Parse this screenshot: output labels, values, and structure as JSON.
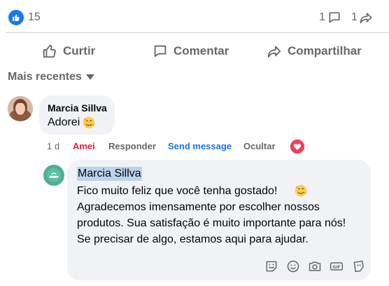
{
  "stats": {
    "reactions_count": "15",
    "comments_count": "1",
    "shares_count": "1"
  },
  "actions": {
    "like": "Curtir",
    "comment": "Comentar",
    "share": "Compartilhar"
  },
  "sort": {
    "label": "Mais recentes"
  },
  "comment": {
    "author": "Marcia Sillva",
    "text": "Adorei",
    "time": "1 d",
    "reaction_label": "Amei",
    "reply_label": "Responder",
    "send_message_label": "Send message",
    "hide_label": "Ocultar"
  },
  "reply": {
    "author": "Marcia Sillva",
    "lines": [
      "Fico muito feliz que você tenha gostado!",
      "Agradecemos imensamente por escolher nossos",
      "produtos. Sua satisfação é muito importante para nós!",
      "Se precisar de algo, estamos aqui para ajudar."
    ]
  },
  "colors": {
    "accent": "#1877f2",
    "love_red": "#e41e3f",
    "link_blue": "#1b74e4",
    "bubble_bg": "#f0f2f5",
    "secondary_text": "#65676b"
  },
  "icons": {
    "reaction": "like-thumb-icon",
    "comment": "speech-bubble-icon",
    "share": "share-arrow-icon",
    "love": "heart-icon",
    "toolbar": [
      "sticker-icon",
      "emoji-icon",
      "camera-icon",
      "gif-icon",
      "avatar-sticker-icon"
    ]
  }
}
